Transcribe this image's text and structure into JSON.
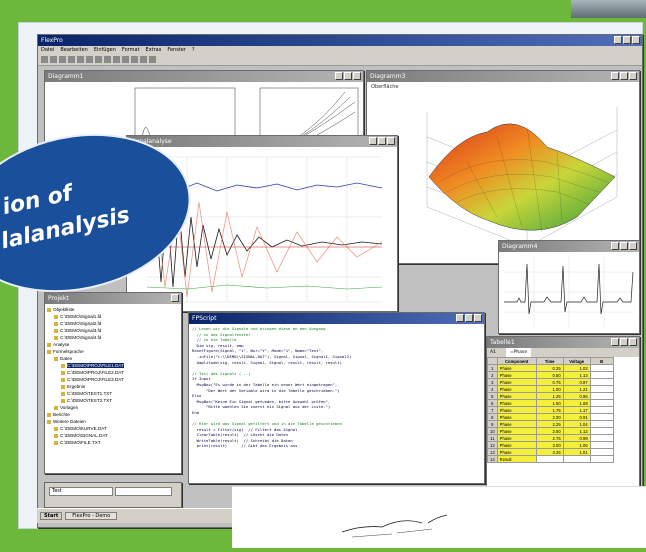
{
  "main_window": {
    "title": "FlexPro",
    "menu": [
      "Datei",
      "Bearbeiten",
      "Einfügen",
      "Format",
      "Extras",
      "Fenster",
      "?"
    ]
  },
  "windows": {
    "chart_small": {
      "title": "Diagramm1"
    },
    "surface_3d": {
      "title": "Diagramm3",
      "label": "Oberfläche"
    },
    "signal_chart": {
      "title": "Signalanalyse"
    },
    "ecg_chart": {
      "title": "Diagramm4"
    },
    "object_tree": {
      "title": "Projekt"
    },
    "code_editor": {
      "title": "FPScript"
    },
    "spreadsheet": {
      "title": "Tabelle1"
    }
  },
  "badge": {
    "line1": "ion of",
    "line2": "lalanalysis"
  },
  "object_tree": {
    "items": [
      {
        "label": "Objektliste",
        "level": 0
      },
      {
        "label": "C:\\DEMO\\Signal1.fd",
        "level": 1
      },
      {
        "label": "C:\\DEMO\\Signal2.fd",
        "level": 1
      },
      {
        "label": "C:\\DEMO\\Signal3.fd",
        "level": 1
      },
      {
        "label": "C:\\DEMO\\Signal4.fd",
        "level": 1
      },
      {
        "label": "Analyse",
        "level": 0
      },
      {
        "label": "Formelsprache",
        "level": 0
      },
      {
        "label": "Daten",
        "level": 1
      },
      {
        "label": "C:\\DEMO\\PROJ\\FILE1.DAT",
        "level": 2,
        "selected": true
      },
      {
        "label": "C:\\DEMO\\PROJ\\FILE2.DAT",
        "level": 2
      },
      {
        "label": "C:\\DEMO\\PROJ\\FILE3.DAT",
        "level": 2
      },
      {
        "label": "Ergebnis",
        "level": 2
      },
      {
        "label": "C:\\DEMO\\TEST1.TXT",
        "level": 2
      },
      {
        "label": "C:\\DEMO\\TEST2.TXT",
        "level": 2
      },
      {
        "label": "Vorlagen",
        "level": 1
      },
      {
        "label": "Berichte",
        "level": 0
      },
      {
        "label": "Weitere Dateien",
        "level": 0
      },
      {
        "label": "C:\\DEMO\\KURVE.DAT",
        "level": 1
      },
      {
        "label": "C:\\DEMO\\SIGNAL.DAT",
        "level": 1
      },
      {
        "label": "C:\\DEMO\\FILE.TXT",
        "level": 1
      }
    ],
    "dropdown_value": "Test"
  },
  "code_editor": {
    "lines": [
      {
        "text": "// Lesen wir die Signale und bringen diese an den Ausgang",
        "comment": true
      },
      {
        "text": "  // in das Signalfenster",
        "comment": true
      },
      {
        "text": "  // in die Tabelle",
        "comment": true
      },
      {
        "text": "  Dim sig, result, amp",
        "comment": false
      },
      {
        "text": "ResetFigure(Signal, \"1\", Nur=\"Y\", Mode=\"1\", Name=\"Test\",",
        "comment": false
      },
      {
        "text": "  .inFile(\"C:\\\\DEMO\\\\SIGNAL.DAT\"), Signal, Signal, Signal1, Signal2)",
        "comment": false
      },
      {
        "text": "  Amplitude(sig, result, Signal, Signal, result, result, result)",
        "comment": false
      },
      {
        "text": "",
        "comment": false
      },
      {
        "text": "// Teil des Signals (...)",
        "comment": true
      },
      {
        "text": "If Input",
        "comment": false
      },
      {
        "text": "  MsgBox(\"Es wurde in der Tabelle ein neuer Wert eingetragen\",",
        "comment": false
      },
      {
        "text": "      \"Der Wert der Variable wird in die Tabelle geschrieben.\")",
        "comment": false
      },
      {
        "text": "Else",
        "comment": false
      },
      {
        "text": "  MsgBox(\"Keine Ein Signal gefunden, bitte Auswahl prüfen\",",
        "comment": false
      },
      {
        "text": "      \"Bitte waehlen Sie zuerst ein Signal aus der Liste.\")",
        "comment": false
      },
      {
        "text": "End",
        "comment": false
      },
      {
        "text": "",
        "comment": false
      },
      {
        "text": "// Hier wird das Signal gefiltert und in die Tabelle geschrieben",
        "comment": true
      },
      {
        "text": "  result = Filter(sig)  // Filtert das Signal",
        "comment": false
      },
      {
        "text": "  ClearTable(result)  // Löscht die Daten",
        "comment": false
      },
      {
        "text": "  WriteTable(result)  // Schreibt die Daten",
        "comment": false
      },
      {
        "text": "  print(result)      // Gibt das Ergebnis aus",
        "comment": false
      }
    ]
  },
  "spreadsheet": {
    "cell_ref": "A1",
    "cell_value": "=Phase",
    "headers": [
      "",
      "Component",
      "Time",
      "Voltage",
      "B"
    ],
    "rows": [
      [
        "1",
        "Phase",
        "0.25",
        "1.02",
        ""
      ],
      [
        "2",
        "Phase",
        "0.50",
        "1.13",
        ""
      ],
      [
        "3",
        "Phase",
        "0.75",
        "0.87",
        ""
      ],
      [
        "4",
        "Phase",
        "1.00",
        "1.21",
        ""
      ],
      [
        "5",
        "Phase",
        "1.25",
        "0.96",
        ""
      ],
      [
        "6",
        "Phase",
        "1.50",
        "1.08",
        ""
      ],
      [
        "7",
        "Phase",
        "1.75",
        "1.17",
        ""
      ],
      [
        "8",
        "Phase",
        "2.00",
        "0.91",
        ""
      ],
      [
        "9",
        "Phase",
        "2.25",
        "1.04",
        ""
      ],
      [
        "10",
        "Phase",
        "2.50",
        "1.12",
        ""
      ],
      [
        "11",
        "Phase",
        "2.75",
        "0.99",
        ""
      ],
      [
        "12",
        "Phase",
        "3.00",
        "1.06",
        ""
      ],
      [
        "13",
        "Phase",
        "3.25",
        "1.01",
        ""
      ],
      [
        "14",
        "Result",
        "",
        "",
        ""
      ]
    ]
  },
  "taskbar": {
    "start_label": "Start",
    "task_label": "FlexPro - Demo"
  },
  "colors": {
    "background": "#6cb83a",
    "badge": "#1a4f9c",
    "title_active": "#0a246a",
    "highlight": "#f4ef3a"
  }
}
